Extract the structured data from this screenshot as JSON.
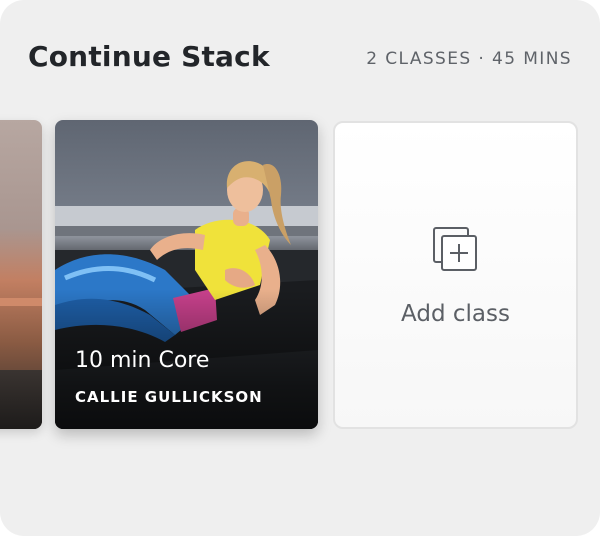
{
  "stack": {
    "title": "Continue Stack",
    "summary": "2 CLASSES · 45 MINS"
  },
  "class_card": {
    "title": "10 min Core",
    "instructor": "CALLIE GULLICKSON"
  },
  "add_card": {
    "label": "Add class",
    "icon": "add-to-stack-icon"
  },
  "colors": {
    "panel_bg": "#efefef",
    "title_text": "#222529",
    "meta_text": "#5f6369"
  }
}
